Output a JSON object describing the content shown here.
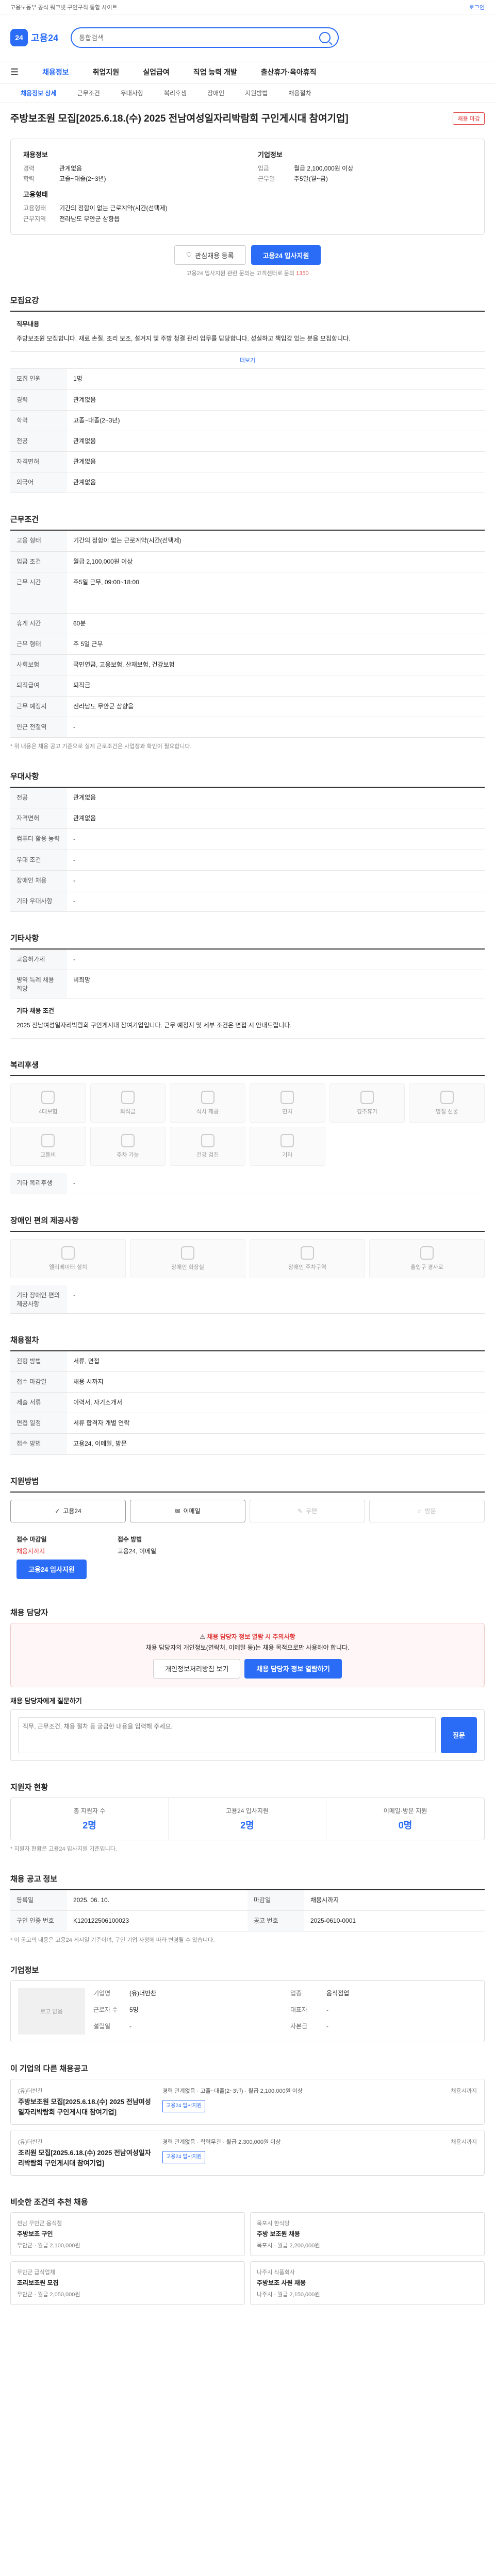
{
  "topbar": {
    "notice": "고용노동부 공식 워크넷 구인구직 통합 사이트",
    "login": "로그인"
  },
  "header": {
    "logo_text": "고용24",
    "logo_mark": "24",
    "search_placeholder": "통합검색"
  },
  "gnb": [
    "채용정보",
    "취업지원",
    "실업급여",
    "직업 능력 개발",
    "출산휴가·육아휴직"
  ],
  "lnb": [
    "채용정보 상세",
    "근무조건",
    "우대사항",
    "복리후생",
    "장애인",
    "지원방법",
    "채용절차"
  ],
  "job": {
    "title": "주방보조원 모집[2025.6.18.(수) 2025 전남여성일자리박람회 구인게시대 참여기업]",
    "badge": "채용 마감",
    "company_section": "채용정보",
    "company_label": "기업정보",
    "summary_left": [
      {
        "k": "경력",
        "v": "관계없음"
      },
      {
        "k": "학력",
        "v": "고졸~대졸(2~3년)"
      }
    ],
    "summary_right": [
      {
        "k": "임금",
        "v": "월급 2,100,000원 이상"
      },
      {
        "k": "근무일",
        "v": "주5일(월~금)"
      }
    ],
    "conditions_label": "고용형태",
    "conditions": [
      {
        "k": "고용형태",
        "v": "기간의 정함이 없는 근로계약(시간(선택제)"
      },
      {
        "k": "근무지역",
        "v": "전라남도 무안군 삼향읍"
      }
    ],
    "scrap_btn": "관심채용 등록",
    "apply_btn": "고용24 입사지원",
    "help": "고용24 입사지원 관련 문의는 고객센터로 문의",
    "help_link": "1350"
  },
  "sections": {
    "recruit": {
      "title": "모집요강",
      "desc_label": "직무내용",
      "desc": "주방보조원 모집합니다. 재료 손질, 조리 보조, 설거지 및 주방 청결 관리 업무를 담당합니다. 성실하고 책임감 있는 분을 모집합니다.",
      "more": "더보기",
      "rows": [
        {
          "k": "모집 인원",
          "v": "1명"
        },
        {
          "k": "경력",
          "v": "관계없음"
        },
        {
          "k": "학력",
          "v": "고졸~대졸(2~3년)"
        },
        {
          "k": "전공",
          "v": "관계없음"
        },
        {
          "k": "자격면허",
          "v": "관계없음"
        },
        {
          "k": "외국어",
          "v": "관계없음"
        }
      ]
    },
    "work": {
      "title": "근무조건",
      "rows": [
        {
          "k": "고용 형태",
          "v": "기간의 정함이 없는 근로계약(시간(선택제)"
        },
        {
          "k": "임금 조건",
          "v": "월급 2,100,000원 이상"
        },
        {
          "k": "근무 시간",
          "v": "주5일 근무, 09:00~18:00"
        },
        {
          "k": "휴게 시간",
          "v": "60분"
        },
        {
          "k": "근무 형태",
          "v": "주 5일 근무"
        },
        {
          "k": "사회보험",
          "v": "국민연금, 고용보험, 산재보험, 건강보험"
        },
        {
          "k": "퇴직급여",
          "v": "퇴직금"
        },
        {
          "k": "근무 예정지",
          "v": "전라남도 무안군 삼향읍"
        },
        {
          "k": "인근 전철역",
          "v": "-"
        }
      ],
      "note": "* 위 내용은 채용 공고 기준으로 실제 근로조건은 사업장과 확인이 필요합니다."
    },
    "prefer": {
      "title": "우대사항",
      "rows": [
        {
          "k": "전공",
          "v": "관계없음"
        },
        {
          "k": "자격면허",
          "v": "관계없음"
        },
        {
          "k": "컴퓨터 활용 능력",
          "v": "-"
        },
        {
          "k": "우대 조건",
          "v": "-"
        },
        {
          "k": "장애인 채용",
          "v": "-"
        },
        {
          "k": "기타 우대사항",
          "v": "-"
        }
      ]
    },
    "other": {
      "title": "기타사항",
      "rows": [
        {
          "k": "고용허가제",
          "v": "-"
        },
        {
          "k": "병역 특례 채용 희망",
          "v": "비희망"
        }
      ],
      "desc_label": "기타 채용 조건",
      "desc": "2025 전남여성일자리박람회 구인게시대 참여기업입니다. 근무 예정지 및 세부 조건은 면접 시 안내드립니다."
    },
    "welfare": {
      "title": "복리후생",
      "items": [
        "4대보험",
        "퇴직금",
        "식사 제공",
        "연차",
        "경조휴가",
        "명절 선물",
        "교통비",
        "주차 가능",
        "건강 검진",
        "기타"
      ],
      "etc_label": "기타 복리후생",
      "etc": "-"
    },
    "disability": {
      "title": "장애인 편의 제공사항",
      "items": [
        "엘리베이터 설치",
        "장애인 화장실",
        "장애인 주차구역",
        "출입구 경사로"
      ],
      "etc_label": "기타 장애인 편의 제공사항",
      "etc": "-"
    },
    "process": {
      "title": "채용절차",
      "rows": [
        {
          "k": "전형 방법",
          "v": "서류, 면접"
        },
        {
          "k": "접수 마감일",
          "v": "채용 시까지"
        },
        {
          "k": "제출 서류",
          "v": "이력서, 자기소개서"
        },
        {
          "k": "면접 일정",
          "v": "서류 합격자 개별 연락"
        },
        {
          "k": "접수 방법",
          "v": "고용24, 이메일, 방문"
        }
      ]
    },
    "apply": {
      "title": "지원방법",
      "cards": [
        "고용24",
        "이메일",
        "우편",
        "방문"
      ],
      "active": [
        true,
        true,
        false,
        false
      ],
      "left_label": "접수 마감일",
      "left_value": "채용시까지",
      "apply_btn": "고용24 입사지원",
      "right_label": "접수 방법",
      "right_value": "고용24, 이메일"
    },
    "contact": {
      "title": "채용 담당자",
      "warn": "채용 담당자 정보 열람 시 주의사항",
      "text": "채용 담당자의 개인정보(연락처, 이메일 등)는 채용 목적으로만 사용해야 합니다.",
      "btn1": "개인정보처리방침 보기",
      "btn2": "채용 담당자 정보 열람하기",
      "qa_title": "채용 담당자에게 질문하기",
      "qa_placeholder": "직무, 근무조건, 채용 절차 등 궁금한 내용을 입력해 주세요.",
      "qa_btn": "질문"
    },
    "stats": {
      "title": "지원자 현황",
      "items": [
        {
          "k": "총 지원자 수",
          "v": "2명"
        },
        {
          "k": "고용24 입사지원",
          "v": "2명"
        },
        {
          "k": "이메일·방문 지원",
          "v": "0명"
        }
      ],
      "note": "* 지원자 현황은 고용24 입사지원 기준입니다."
    },
    "notice_info": {
      "title": "채용 공고 정보",
      "rows": [
        {
          "k": "등록일",
          "v": "2025. 06. 10."
        },
        {
          "k": "마감일",
          "v": "채용시까지"
        },
        {
          "k": "구인 인증 번호",
          "v": "K120122506100023"
        },
        {
          "k": "공고 번호",
          "v": "2025-0610-0001"
        }
      ],
      "note": "* 이 공고의 내용은 고용24 게시일 기준이며, 구인 기업 사정에 따라 변경될 수 있습니다."
    },
    "company": {
      "title": "기업정보",
      "logo": "로고 없음",
      "rows": [
        {
          "k": "기업명",
          "v": "(유)더반찬"
        },
        {
          "k": "업종",
          "v": "음식점업"
        },
        {
          "k": "근로자 수",
          "v": "5명"
        },
        {
          "k": "대표자",
          "v": "-"
        },
        {
          "k": "설립일",
          "v": "-"
        },
        {
          "k": "자본금",
          "v": "-"
        }
      ]
    },
    "same_company": {
      "title": "이 기업의 다른 채용공고",
      "jobs": [
        {
          "co": "(유)더반찬",
          "t": "주방보조원 모집[2025.6.18.(수) 2025 전남여성일자리박람회 구인게시대 참여기업]",
          "meta": "경력 관계없음 · 고졸~대졸(2~3년) · 월급 2,100,000원 이상",
          "tag": "고용24 입사지원",
          "deadline": "채용시까지"
        },
        {
          "co": "(유)더반찬",
          "t": "조리원 모집[2025.6.18.(수) 2025 전남여성일자리박람회 구인게시대 참여기업]",
          "meta": "경력 관계없음 · 학력무관 · 월급 2,300,000원 이상",
          "tag": "고용24 입사지원",
          "deadline": "채용시까지"
        }
      ]
    },
    "recommend": {
      "title": "비슷한 조건의 추천 채용",
      "items": [
        {
          "co": "전남 무안군 음식점",
          "t": "주방보조 구인",
          "meta": "무안군 · 월급 2,100,000원"
        },
        {
          "co": "목포시 한식당",
          "t": "주방 보조원 채용",
          "meta": "목포시 · 월급 2,200,000원"
        },
        {
          "co": "무안군 급식업체",
          "t": "조리보조원 모집",
          "meta": "무안군 · 월급 2,050,000원"
        },
        {
          "co": "나주시 식품회사",
          "t": "주방보조 사원 채용",
          "meta": "나주시 · 월급 2,150,000원"
        }
      ]
    }
  }
}
